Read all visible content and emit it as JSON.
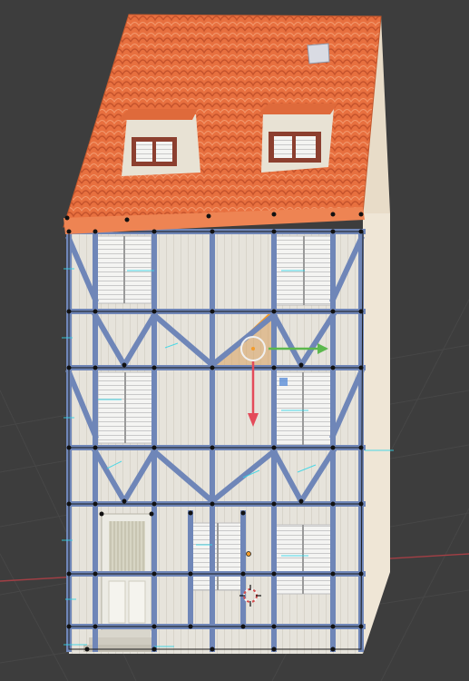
{
  "viewport": {
    "background_color": "#3d3d3d",
    "grid_color": "#4a4a4a",
    "x_axis_color": "#b8444b",
    "y_axis_color": "#6c9a2e"
  },
  "model": {
    "roof_color": "#e8703f",
    "wall_color": "#e3e0d8",
    "side_wall_color": "#efe6d6",
    "timber_color": "#6f86b8",
    "vertex_color": "#111111",
    "normal_color": "#2fd6e8"
  },
  "gizmo": {
    "x_arrow_color": "#5cb84d",
    "y_arrow_color": "#e44b5a",
    "selection_color": "#f39b2b",
    "center_icon": "move-gizmo-circle-icon",
    "cursor_icon": "3d-cursor-icon"
  }
}
